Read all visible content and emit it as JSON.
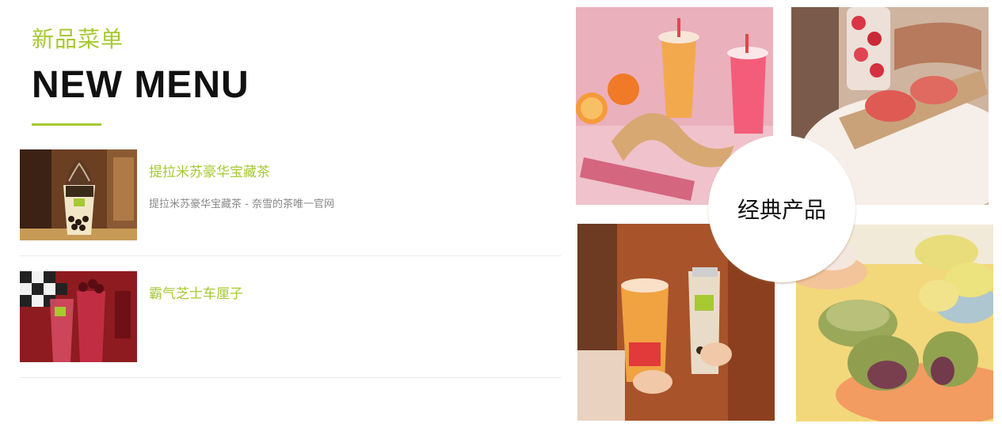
{
  "header": {
    "subtitle": "新品菜单",
    "title": "NEW MENU"
  },
  "menu_items": [
    {
      "title": "提拉米苏豪华宝藏茶",
      "description": "提拉米苏豪华宝藏茶 - 奈雪的茶唯一官网"
    },
    {
      "title": "霸气芝士车厘子",
      "description": ""
    }
  ],
  "gallery": {
    "badge_label": "经典产品"
  },
  "colors": {
    "accent": "#a6c931",
    "title": "#111111",
    "description": "#888888"
  }
}
